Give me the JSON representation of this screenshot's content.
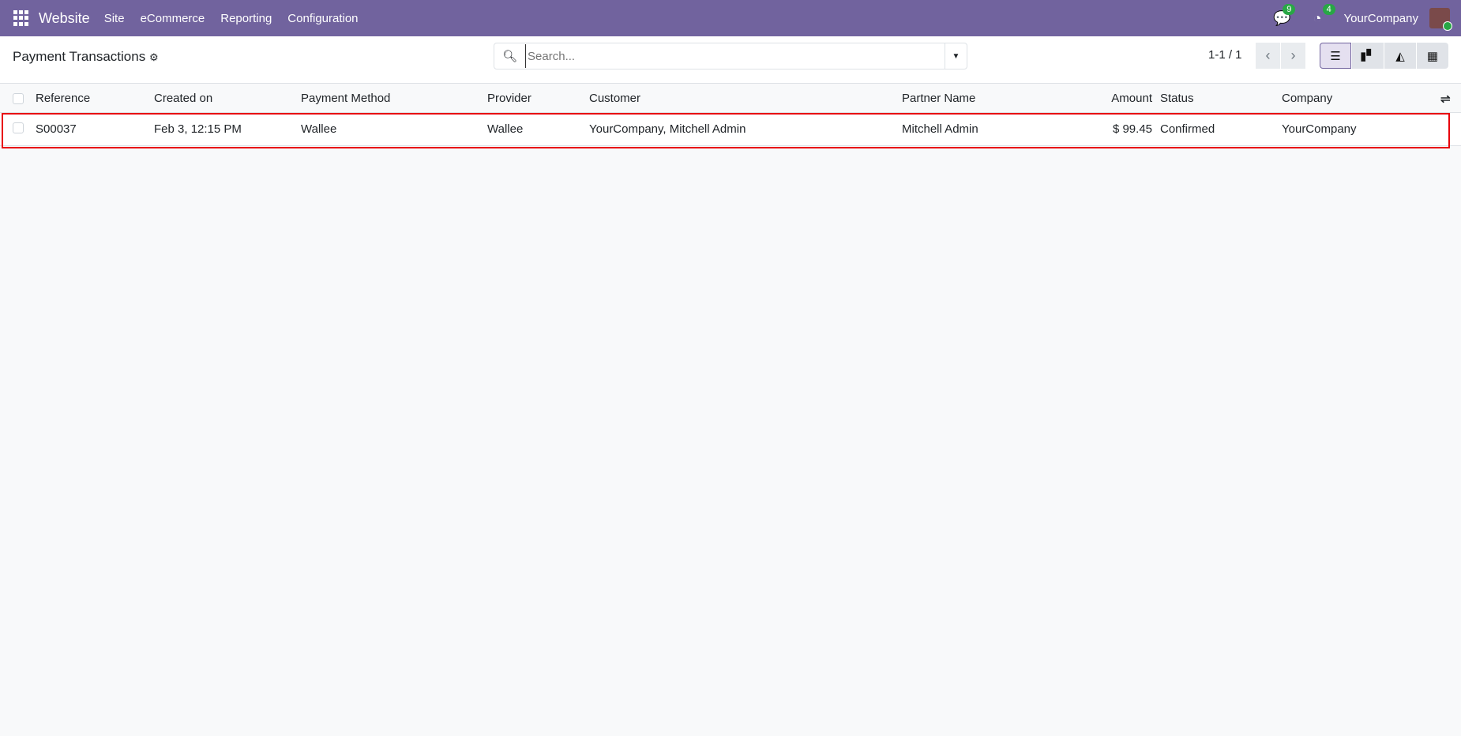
{
  "navbar": {
    "app": "Website",
    "menu": [
      "Site",
      "eCommerce",
      "Reporting",
      "Configuration"
    ],
    "messages_count": "9",
    "activities_count": "4",
    "company": "YourCompany"
  },
  "control": {
    "title": "Payment Transactions",
    "search_placeholder": "Search...",
    "pager": "1-1 / 1"
  },
  "table": {
    "headers": [
      "Reference",
      "Created on",
      "Payment Method",
      "Provider",
      "Customer",
      "Partner Name",
      "Amount",
      "Status",
      "Company"
    ],
    "rows": [
      [
        "S00037",
        "Feb 3, 12:15 PM",
        "Wallee",
        "Wallee",
        "YourCompany, Mitchell Admin",
        "Mitchell Admin",
        "$ 99.45",
        "Confirmed",
        "YourCompany"
      ]
    ]
  },
  "colors": {
    "navbar": "#71639e",
    "highlight": "#e8000b",
    "badge": "#28a745"
  }
}
